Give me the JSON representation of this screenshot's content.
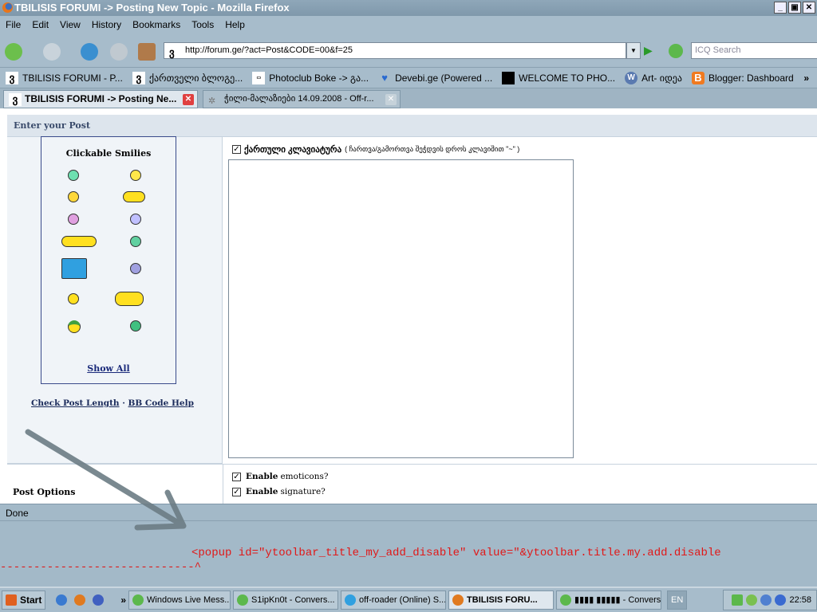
{
  "window": {
    "title": "TBILISIS FORUMI -> Posting New Topic - Mozilla Firefox"
  },
  "menu": [
    "File",
    "Edit",
    "View",
    "History",
    "Bookmarks",
    "Tools",
    "Help"
  ],
  "nav": {
    "url": "http://forum.ge/?act=Post&CODE=00&f=25",
    "search_placeholder": "ICQ Search"
  },
  "bookmarks": [
    "TBILISIS FORUMI - P...",
    "ქართველი ბლოგე...",
    "Photoclub Boke -> გა...",
    "Devebi.ge (Powered ...",
    "WELCOME TO PHO...",
    "Art- იდეა",
    "Blogger: Dashboard"
  ],
  "bookmarks_more": "»",
  "tabs": [
    {
      "label": "TBILISIS FORUMI -> Posting Ne..."
    },
    {
      "label": "ჭილი-მალაზიები 14.09.2008 - Off-r..."
    }
  ],
  "page": {
    "section_title": "Enter your Post",
    "smilies_title": "Clickable Smilies",
    "show_all": "Show All",
    "check_post_length": "Check Post Length",
    "separator": "·",
    "bb_code_help": "BB Code Help",
    "keyboard_label": "ქართული კლავიატურა",
    "keyboard_hint": "( ჩართვა/გამორთვა შეჭდვის დროს კლავიშით \"~\" )",
    "post_options": "Post Options",
    "options": [
      {
        "bold": "Enable",
        "rest": "emoticons?",
        "checked": true
      },
      {
        "bold": "Enable",
        "rest": "signature?",
        "checked": true
      }
    ]
  },
  "status": "Done",
  "error": {
    "line": "<popup id=\"ytoolbar_title_my_add_disable\" value=\"&ytoolbar.title.my.add.disable",
    "marker": "-----------------------------^"
  },
  "taskbar": {
    "start": "Start",
    "more": "»",
    "items": [
      "Windows Live Mess...",
      "S1ipKn0t - Convers...",
      "off-roader (Online) S...",
      "TBILISIS FORU...",
      "▮▮▮▮ ▮▮▮▮▮ - Conversat..."
    ],
    "lang": "EN",
    "clock": "22:58"
  }
}
